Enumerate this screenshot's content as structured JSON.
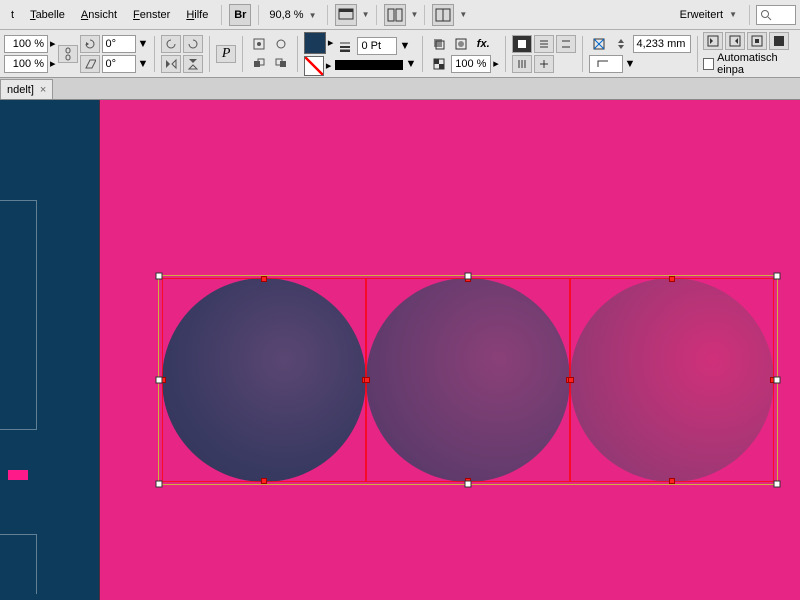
{
  "menu": {
    "items": [
      "t",
      "Tabelle",
      "Ansicht",
      "Fenster",
      "Hilfe"
    ],
    "bridge": "Br",
    "zoom": "90,8 %",
    "workspace": "Erweitert"
  },
  "control": {
    "opacity1": "100 %",
    "opacity2": "100 %",
    "angle1": "0°",
    "angle2": "0°",
    "stroke_weight": "0 Pt",
    "stroke_opacity": "100 %",
    "measure": "4,233 mm",
    "autofit": "Automatisch einpa"
  },
  "tab": {
    "title": "ndelt]",
    "close": "×"
  },
  "canvas": {
    "bg": "#e62585",
    "pasteboard": "#0d3b5c"
  }
}
